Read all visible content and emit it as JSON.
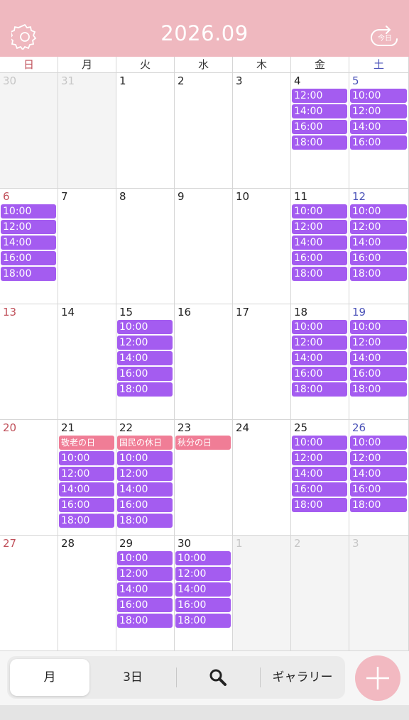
{
  "header": {
    "title": "2026.09",
    "settings_icon": "gear-icon",
    "today_icon": "today-icon",
    "today_label": "今日",
    "background": "#efb8bf"
  },
  "weekdays": [
    "日",
    "月",
    "火",
    "水",
    "木",
    "金",
    "土"
  ],
  "colors": {
    "event": "#a45cf0",
    "holiday": "#f07d96",
    "sunday": "#c0505a",
    "saturday": "#4a52b8"
  },
  "weeks": [
    [
      {
        "day": "30",
        "other": true,
        "events": []
      },
      {
        "day": "31",
        "other": true,
        "events": []
      },
      {
        "day": "1",
        "events": []
      },
      {
        "day": "2",
        "events": []
      },
      {
        "day": "3",
        "events": []
      },
      {
        "day": "4",
        "events": [
          "12:00",
          "14:00",
          "16:00",
          "18:00"
        ]
      },
      {
        "day": "5",
        "events": [
          "10:00",
          "12:00",
          "14:00",
          "16:00"
        ]
      }
    ],
    [
      {
        "day": "6",
        "events": [
          "10:00",
          "12:00",
          "14:00",
          "16:00",
          "18:00"
        ]
      },
      {
        "day": "7",
        "events": []
      },
      {
        "day": "8",
        "events": []
      },
      {
        "day": "9",
        "events": []
      },
      {
        "day": "10",
        "events": []
      },
      {
        "day": "11",
        "events": [
          "10:00",
          "12:00",
          "14:00",
          "16:00",
          "18:00"
        ]
      },
      {
        "day": "12",
        "events": [
          "10:00",
          "12:00",
          "14:00",
          "16:00",
          "18:00"
        ]
      }
    ],
    [
      {
        "day": "13",
        "events": []
      },
      {
        "day": "14",
        "events": []
      },
      {
        "day": "15",
        "events": [
          "10:00",
          "12:00",
          "14:00",
          "16:00",
          "18:00"
        ]
      },
      {
        "day": "16",
        "events": []
      },
      {
        "day": "17",
        "events": []
      },
      {
        "day": "18",
        "events": [
          "10:00",
          "12:00",
          "14:00",
          "16:00",
          "18:00"
        ]
      },
      {
        "day": "19",
        "events": [
          "10:00",
          "12:00",
          "14:00",
          "16:00",
          "18:00"
        ]
      }
    ],
    [
      {
        "day": "20",
        "events": []
      },
      {
        "day": "21",
        "holiday": "敬老の日",
        "events": [
          "10:00",
          "12:00",
          "14:00",
          "16:00",
          "18:00"
        ]
      },
      {
        "day": "22",
        "holiday": "国民の休日",
        "events": [
          "10:00",
          "12:00",
          "14:00",
          "16:00",
          "18:00"
        ]
      },
      {
        "day": "23",
        "holiday": "秋分の日",
        "events": []
      },
      {
        "day": "24",
        "events": []
      },
      {
        "day": "25",
        "events": [
          "10:00",
          "12:00",
          "14:00",
          "16:00",
          "18:00"
        ]
      },
      {
        "day": "26",
        "events": [
          "10:00",
          "12:00",
          "14:00",
          "16:00",
          "18:00"
        ]
      }
    ],
    [
      {
        "day": "27",
        "events": []
      },
      {
        "day": "28",
        "events": []
      },
      {
        "day": "29",
        "events": [
          "10:00",
          "12:00",
          "14:00",
          "16:00",
          "18:00"
        ]
      },
      {
        "day": "30",
        "events": [
          "10:00",
          "12:00",
          "14:00",
          "16:00",
          "18:00"
        ]
      },
      {
        "day": "1",
        "other": true,
        "events": []
      },
      {
        "day": "2",
        "other": true,
        "events": []
      },
      {
        "day": "3",
        "other": true,
        "events": []
      }
    ]
  ],
  "bottom": {
    "month_label": "月",
    "threeday_label": "3日",
    "search_icon": "search-icon",
    "gallery_label": "ギャラリー",
    "add_icon": "plus-icon"
  }
}
